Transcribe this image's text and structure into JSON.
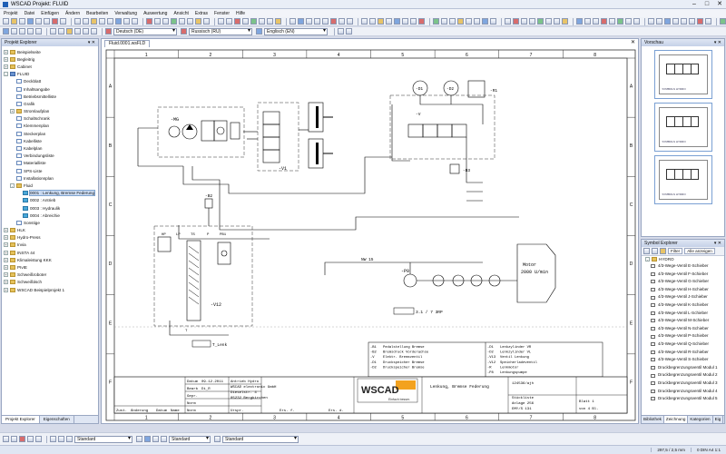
{
  "window": {
    "title": "WSCAD  Projekt: FLUID"
  },
  "menu": [
    "Projekt",
    "Datei",
    "Einfügen",
    "Ändern",
    "Bearbeiten",
    "Verwaltung",
    "Auswertung",
    "Ansicht",
    "Extras",
    "Fenster",
    "Hilfe"
  ],
  "toolbar": {
    "lang1": "Deutsch (DE)",
    "lang2": "Russisch (RU)",
    "lang3": "Englisch (EN)",
    "style1": "Standard",
    "style2": "Standard",
    "style3": "Standard"
  },
  "explorer": {
    "title": "Projekt Explorer",
    "items": [
      {
        "label": "Beispielseite",
        "indent": 0,
        "exp": "+",
        "icon": "folder"
      },
      {
        "label": "Begleitrig",
        "indent": 0,
        "exp": "+",
        "icon": "folder"
      },
      {
        "label": "Cabinet",
        "indent": 0,
        "exp": "+",
        "icon": "folder"
      },
      {
        "label": "FLUID",
        "indent": 0,
        "exp": "-",
        "icon": "proj"
      },
      {
        "label": "Deckblatt",
        "indent": 1,
        "exp": "",
        "icon": "doc"
      },
      {
        "label": "Inhaltsangabe",
        "indent": 1,
        "exp": "",
        "icon": "doc"
      },
      {
        "label": "Betriebsmittelliste",
        "indent": 1,
        "exp": "",
        "icon": "doc"
      },
      {
        "label": "Grafik",
        "indent": 1,
        "exp": "",
        "icon": "doc"
      },
      {
        "label": "Stromlaufplan",
        "indent": 1,
        "exp": "+",
        "icon": "folder"
      },
      {
        "label": "Schaltschrank",
        "indent": 1,
        "exp": "",
        "icon": "doc"
      },
      {
        "label": "Klemmenplan",
        "indent": 1,
        "exp": "",
        "icon": "doc"
      },
      {
        "label": "Steckerplan",
        "indent": 1,
        "exp": "",
        "icon": "doc"
      },
      {
        "label": "Kabelliste",
        "indent": 1,
        "exp": "",
        "icon": "doc"
      },
      {
        "label": "Kabelplan",
        "indent": 1,
        "exp": "",
        "icon": "doc"
      },
      {
        "label": "Verbindungsliste",
        "indent": 1,
        "exp": "",
        "icon": "doc"
      },
      {
        "label": "Materialliste",
        "indent": 1,
        "exp": "",
        "icon": "doc"
      },
      {
        "label": "SPS-Liste",
        "indent": 1,
        "exp": "",
        "icon": "doc"
      },
      {
        "label": "Installationsplan",
        "indent": 1,
        "exp": "",
        "icon": "doc"
      },
      {
        "label": "Fluid",
        "indent": 1,
        "exp": "-",
        "icon": "folder"
      },
      {
        "label": "0001 : Lenkung, Bremse Federung",
        "indent": 2,
        "exp": "",
        "icon": "fluid",
        "selected": true
      },
      {
        "label": "0002 : Antrieb",
        "indent": 2,
        "exp": "",
        "icon": "fluid"
      },
      {
        "label": "0003 : Hydraulik",
        "indent": 2,
        "exp": "",
        "icon": "fluid"
      },
      {
        "label": "0004 : Abreichie",
        "indent": 2,
        "exp": "",
        "icon": "fluid"
      },
      {
        "label": "Sonstige",
        "indent": 1,
        "exp": "",
        "icon": "doc"
      },
      {
        "label": "HLK",
        "indent": 0,
        "exp": "+",
        "icon": "folder"
      },
      {
        "label": "Hydro-Press",
        "indent": 0,
        "exp": "+",
        "icon": "folder"
      },
      {
        "label": "Invia",
        "indent": 0,
        "exp": "+",
        "icon": "folder"
      },
      {
        "label": "INSTA 44",
        "indent": 0,
        "exp": "+",
        "icon": "folder"
      },
      {
        "label": "Klimaleistung KKK",
        "indent": 0,
        "exp": "+",
        "icon": "folder"
      },
      {
        "label": "PIvIE",
        "indent": 0,
        "exp": "+",
        "icon": "folder"
      },
      {
        "label": "Schweißroboter",
        "indent": 0,
        "exp": "+",
        "icon": "folder"
      },
      {
        "label": "Schweißtisch",
        "indent": 0,
        "exp": "+",
        "icon": "folder"
      },
      {
        "label": "WSCAD Beispielprojekt 1",
        "indent": 0,
        "exp": "+",
        "icon": "folder"
      }
    ],
    "tabs": [
      "Projekt Explorer",
      "Eigenschaften"
    ]
  },
  "document": {
    "tab": "Fluid.0001.wsFLD",
    "columns": [
      "1",
      "2",
      "3",
      "4",
      "5",
      "6",
      "7",
      "8"
    ],
    "rows": [
      "A",
      "B",
      "C",
      "D",
      "E",
      "F"
    ],
    "labels": {
      "mg": "-MG",
      "v1": "-V1",
      "v12": "-V12",
      "b2": "-B2",
      "b3": "-B3",
      "p0": "-P0",
      "d1": "-D1",
      "d2": "-D2",
      "r1": "-R1",
      "v": "-V",
      "motor1": "Motor",
      "motor2": "2000 U/min",
      "nw": "NW 15",
      "hp": "HP",
      "lp": "LP",
      "ts": "TS",
      "pb": "PB1",
      "p": "P",
      "t": "T",
      "tlenk": "T_Lenk",
      "t1": "3.1 / 7 3RP"
    },
    "legend": [
      {
        "code": "-B1",
        "text": "Pedalstellung Bremse"
      },
      {
        "code": "-B2",
        "text": "Bremsdruck Vorderachse"
      },
      {
        "code": "-V",
        "text": "Elektr. Bremsventil"
      },
      {
        "code": "-D1",
        "text": "Druckspeicher Bremse"
      },
      {
        "code": "-D2",
        "text": "Druckspeicher Bremse"
      },
      {
        "code": "-D1",
        "text": "Lenkzylinder VR"
      },
      {
        "code": "-D2",
        "text": "Lenkzylinder VL"
      },
      {
        "code": "-V13",
        "text": "Ventil Lenkung"
      },
      {
        "code": "-V12",
        "text": "Speicherladeventil"
      },
      {
        "code": "-R",
        "text": "Lenkmotor"
      },
      {
        "code": "-P8",
        "text": "Lenkungspumpe"
      }
    ],
    "titleblock": {
      "datum_lbl": "Datum",
      "datum": "09.12.2011",
      "bearb_lbl": "Bearb",
      "bearb": "Di_R",
      "gepr_lbl": "Gepr.",
      "norm_lbl": "Norm",
      "company": "Antrieb Hydro",
      "company2": "WSCAD electronic GmbH",
      "company3": "Dieselstr. 4",
      "company4": "85232 Bergkirchen",
      "logo": "WSCAD",
      "logo_sub": "Einfach besser.",
      "project_title": "Lenkung, Bremse Federung",
      "drawing_no": "124536/ajh",
      "field1": "Stückliste",
      "field2": "Anlage 256",
      "field3": "EMY/S 131",
      "blatt": "Blatt 1",
      "von": "von 4  Bl.",
      "zust": "Zust.",
      "aenderung": "Änderung",
      "datum2": "Datum",
      "name": "Name",
      "norm2": "Norm",
      "urspr": "Urspr.",
      "ers": "Ers. f.",
      "ers2": "Ers. d."
    }
  },
  "preview": {
    "title": "Vorschau",
    "thumb_caption": "SYMBOLS HYDRO"
  },
  "symbols": {
    "title": "Symbol Explorer",
    "filter": "Filter",
    "all": "Alle anzeigen",
    "folder": "HYDRO",
    "items": [
      "4/3-Wege-Ventil E-Schieber",
      "4/3-Wege-Ventil F-Schieber",
      "4/3-Wege-Ventil G-Schieber",
      "4/3-Wege-Ventil H-Schieber",
      "4/3-Wege-Ventil J-Schieber",
      "4/3-Wege-Ventil K-Schieber",
      "4/3-Wege-Ventil L-Schieber",
      "4/3-Wege-Ventil M-Schieber",
      "4/3-Wege-Ventil N-Schieber",
      "4/3-Wege-Ventil P-Schieber",
      "4/3-Wege-Ventil Q-Schieber",
      "4/3-Wege-Ventil R-Schieber",
      "4/3-Wege-Ventil S-Schieber",
      "Druckbegrenzungsventil Modul 1",
      "Druckbegrenzungsventil Modul 2",
      "Druckbegrenzungsventil Modul 3",
      "Druckbegrenzungsventil Modul 4",
      "Druckbegrenzungsventil Modul 5",
      "Druckreduzierventil Modul 1"
    ],
    "tabs": [
      "Bibliothek",
      "Zeichnung",
      "Kategorien",
      "Eig"
    ]
  },
  "status": {
    "coords": "297,5 / 2,5 mm",
    "scale": "0  DIN A4  1:1"
  }
}
